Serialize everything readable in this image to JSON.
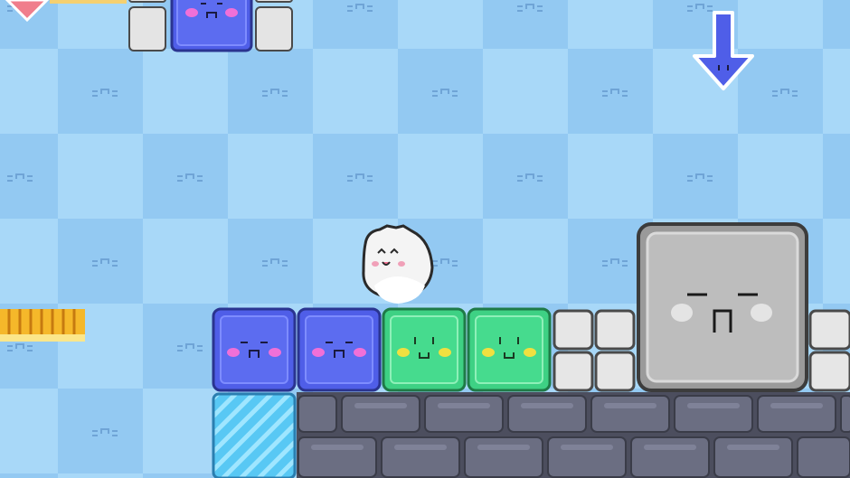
{
  "colors": {
    "bg_light": "#a8d8f8",
    "bg_dark": "#8fc7f0",
    "bg_face": "#6fa7d8",
    "blue_block": "#4f5ee8",
    "blue_block_dark": "#2f3cb8",
    "green_block": "#3ed184",
    "green_block_dark": "#1f9a57",
    "gray_small": "#e4e4e4",
    "gray_big": "#b8b8b8",
    "gray_big_dark": "#4a4a4a",
    "stone": "#5a5c6e",
    "stone_light": "#6d7084",
    "ice": "#58c8f4",
    "arrow_fill": "#4f5ee8",
    "spring": "#f5b82a",
    "blush_pink": "#f070d8",
    "blush_yellow": "#f0e040"
  },
  "sprites": {
    "player": "white-round-blob-character",
    "down_arrow": "down-arrow-sign",
    "pink_arrow": "pink-arrow-sign",
    "spring": "yellow-spring-pad",
    "ice_block": "ice-block",
    "big_block": "big-gray-face-block",
    "blue_face_block": "blue-face-block",
    "green_face_block": "green-face-block",
    "small_gray_block": "small-gray-block",
    "stone_floor": "stone-brick-floor"
  }
}
